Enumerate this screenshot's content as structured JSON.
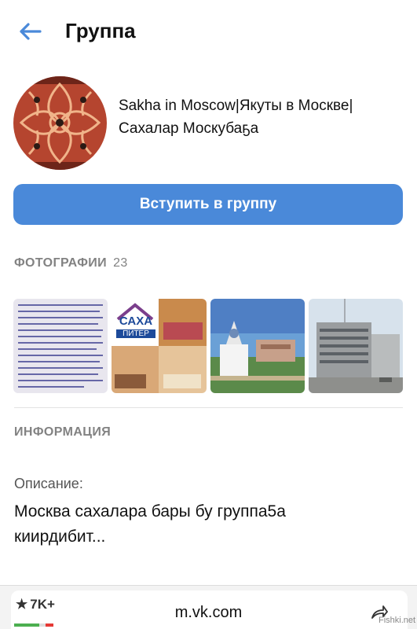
{
  "header": {
    "title": "Группа",
    "back_icon": "arrow-left-icon"
  },
  "group": {
    "name": "Sakha in Moscow|Якуты в Москве|\nСахалар Москубаҕа"
  },
  "join_button": {
    "label": "Вступить в группу"
  },
  "photos": {
    "heading": "ФОТОГРАФИИ",
    "count": "23",
    "logo_text": "САХА",
    "logo_sub": "ПИТЕР"
  },
  "info": {
    "heading": "ИНФОРМАЦИЯ",
    "description_label": "Описание:",
    "description": "Москва сахалара бары бу группа5а\nкиирдибит..."
  },
  "browser": {
    "url": "m.vk.com",
    "rating": "7K+",
    "watermark": "Fishki.net"
  },
  "colors": {
    "accent": "#4a89d9",
    "section_gray": "#828282"
  }
}
